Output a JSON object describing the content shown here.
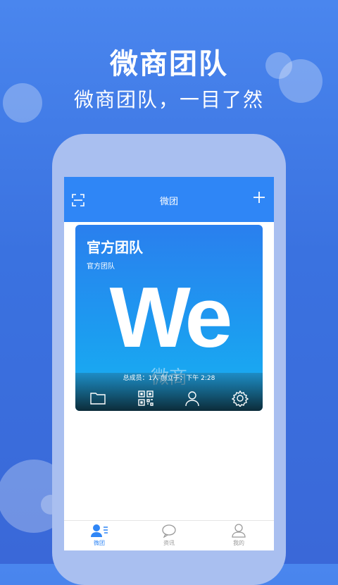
{
  "hero": {
    "title": "微商团队",
    "subtitle": "微商团队，一目了然"
  },
  "appbar": {
    "title": "微团"
  },
  "team_card": {
    "name": "官方团队",
    "subtitle": "官方团队",
    "logo_text": "We",
    "watermark": "微商",
    "meta": "总成员：1人  创立于：下午 2:28",
    "actions": [
      "folder-icon",
      "qr-code-icon",
      "member-icon",
      "settings-icon"
    ]
  },
  "tabbar": {
    "items": [
      {
        "label": "微团",
        "icon": "contacts-icon",
        "active": true
      },
      {
        "label": "资讯",
        "icon": "chat-bubble-icon",
        "active": false
      },
      {
        "label": "我的",
        "icon": "profile-icon",
        "active": false
      }
    ]
  },
  "colors": {
    "accent": "#2f86f6",
    "background": "#3a72e0"
  }
}
